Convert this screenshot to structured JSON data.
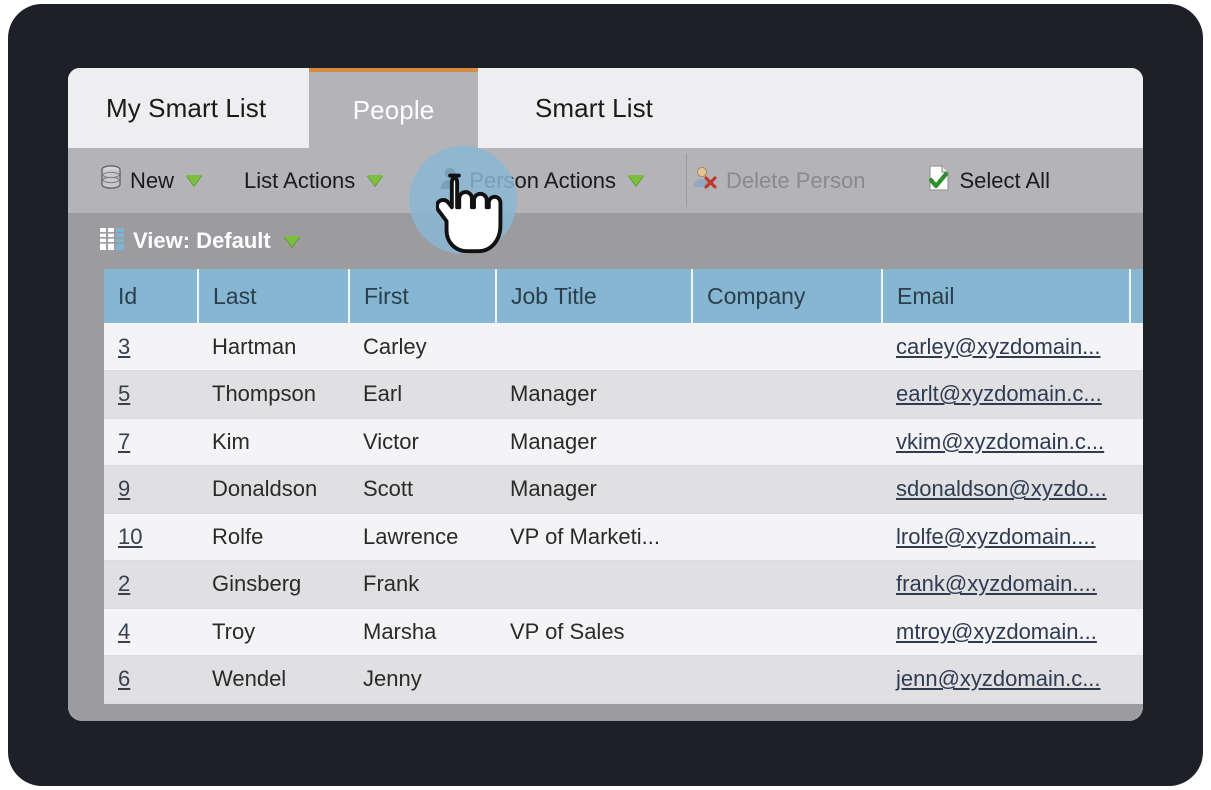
{
  "window": {
    "tabs": [
      {
        "label": "My Smart List",
        "active": false
      },
      {
        "label": "People",
        "active": true
      },
      {
        "label": "Smart List",
        "active": false
      }
    ]
  },
  "toolbar": {
    "new_label": "New",
    "list_actions_label": "List Actions",
    "person_actions_label": "Person Actions",
    "delete_person_label": "Delete Person",
    "select_all_label": "Select All"
  },
  "view_bar": {
    "label": "View: Default"
  },
  "grid": {
    "columns": [
      "Id",
      "Last",
      "First",
      "Job Title",
      "Company",
      "Email",
      ""
    ],
    "rows": [
      {
        "id": "3",
        "last": "Hartman",
        "first": "Carley",
        "job": "",
        "company": "",
        "email": "carley@xyzdomain..."
      },
      {
        "id": "5",
        "last": "Thompson",
        "first": "Earl",
        "job": "Manager",
        "company": "",
        "email": "earlt@xyzdomain.c..."
      },
      {
        "id": "7",
        "last": "Kim",
        "first": "Victor",
        "job": "Manager",
        "company": "",
        "email": "vkim@xyzdomain.c..."
      },
      {
        "id": "9",
        "last": "Donaldson",
        "first": "Scott",
        "job": "Manager",
        "company": "",
        "email": "sdonaldson@xyzdo..."
      },
      {
        "id": "10",
        "last": "Rolfe",
        "first": "Lawrence",
        "job": "VP of Marketi...",
        "company": "",
        "email": "lrolfe@xyzdomain...."
      },
      {
        "id": "2",
        "last": "Ginsberg",
        "first": "Frank",
        "job": "",
        "company": "",
        "email": "frank@xyzdomain...."
      },
      {
        "id": "4",
        "last": "Troy",
        "first": "Marsha",
        "job": "VP of Sales",
        "company": "",
        "email": "mtroy@xyzdomain..."
      },
      {
        "id": "6",
        "last": "Wendel",
        "first": "Jenny",
        "job": "",
        "company": "",
        "email": "jenn@xyzdomain.c..."
      }
    ]
  },
  "colors": {
    "frame": "#1e2027",
    "tab_active_bg": "#b4b4b8",
    "tab_active_accent": "#d98b40",
    "tab_inactive_bg": "#eeeef1",
    "toolbar_bg": "#b4b4b8",
    "view_bar_bg": "#9b9ba0",
    "grid_header_bg": "#86b6d2",
    "row_odd_bg": "#f4f4f6",
    "row_even_bg": "#e0e0e3",
    "link": "#2f3b52",
    "caret_green": "#7cbf3f",
    "ripple": "#8ab6d4"
  }
}
